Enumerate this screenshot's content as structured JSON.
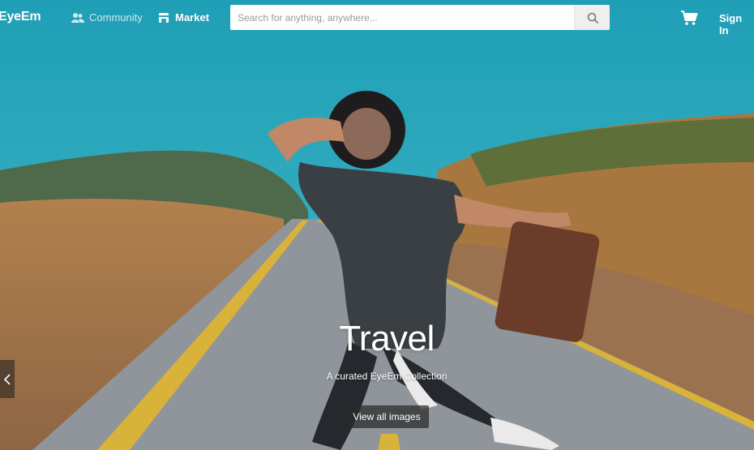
{
  "brand": {
    "logo": "EyeEm"
  },
  "nav": {
    "community": "Community",
    "market": "Market"
  },
  "search": {
    "placeholder": "Search for anything, anywhere..."
  },
  "header": {
    "signin": "Sign In"
  },
  "hero": {
    "title": "Travel",
    "subtitle": "A curated EyeEm Collection",
    "cta": "View all images"
  },
  "icons": {
    "community": "people-icon",
    "market": "store-icon",
    "search": "search-icon",
    "cart": "cart-icon",
    "prev": "chevron-left-icon"
  },
  "colors": {
    "sky": "#2aa6bb",
    "nav_active": "#ffffff",
    "nav_muted": "#cfe9ef"
  }
}
